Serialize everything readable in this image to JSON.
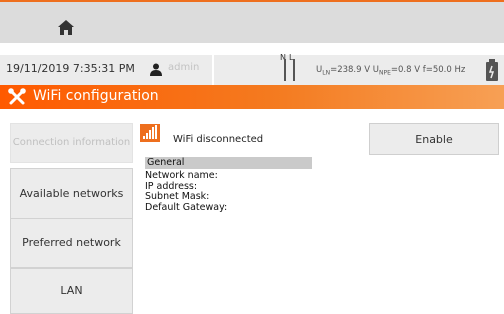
{
  "topbar": {
    "home_icon": "home-icon"
  },
  "status": {
    "datetime": "19/11/2019 7:35:31 PM",
    "user": "admin",
    "phase_labels": [
      "N",
      "L"
    ],
    "ul": "=238.9 V U",
    "une": "=0.8 V f=50.0 Hz",
    "ln_sub": "LN",
    "npe_sub": "NPE"
  },
  "title": "WiFi configuration",
  "sidebar": {
    "items": [
      {
        "label": "Connection information",
        "disabled": true
      },
      {
        "label": "Available networks"
      },
      {
        "label": "Preferred network"
      },
      {
        "label": "LAN"
      }
    ]
  },
  "wifi": {
    "status": "WiFi disconnected",
    "enable_label": "Enable"
  },
  "general": {
    "header": "General",
    "fields": [
      "Network name:",
      "IP address:",
      "Subnet Mask:",
      "Default Gateway:"
    ]
  },
  "colors": {
    "accent": "#ee6f1e",
    "button": "#ececec"
  }
}
